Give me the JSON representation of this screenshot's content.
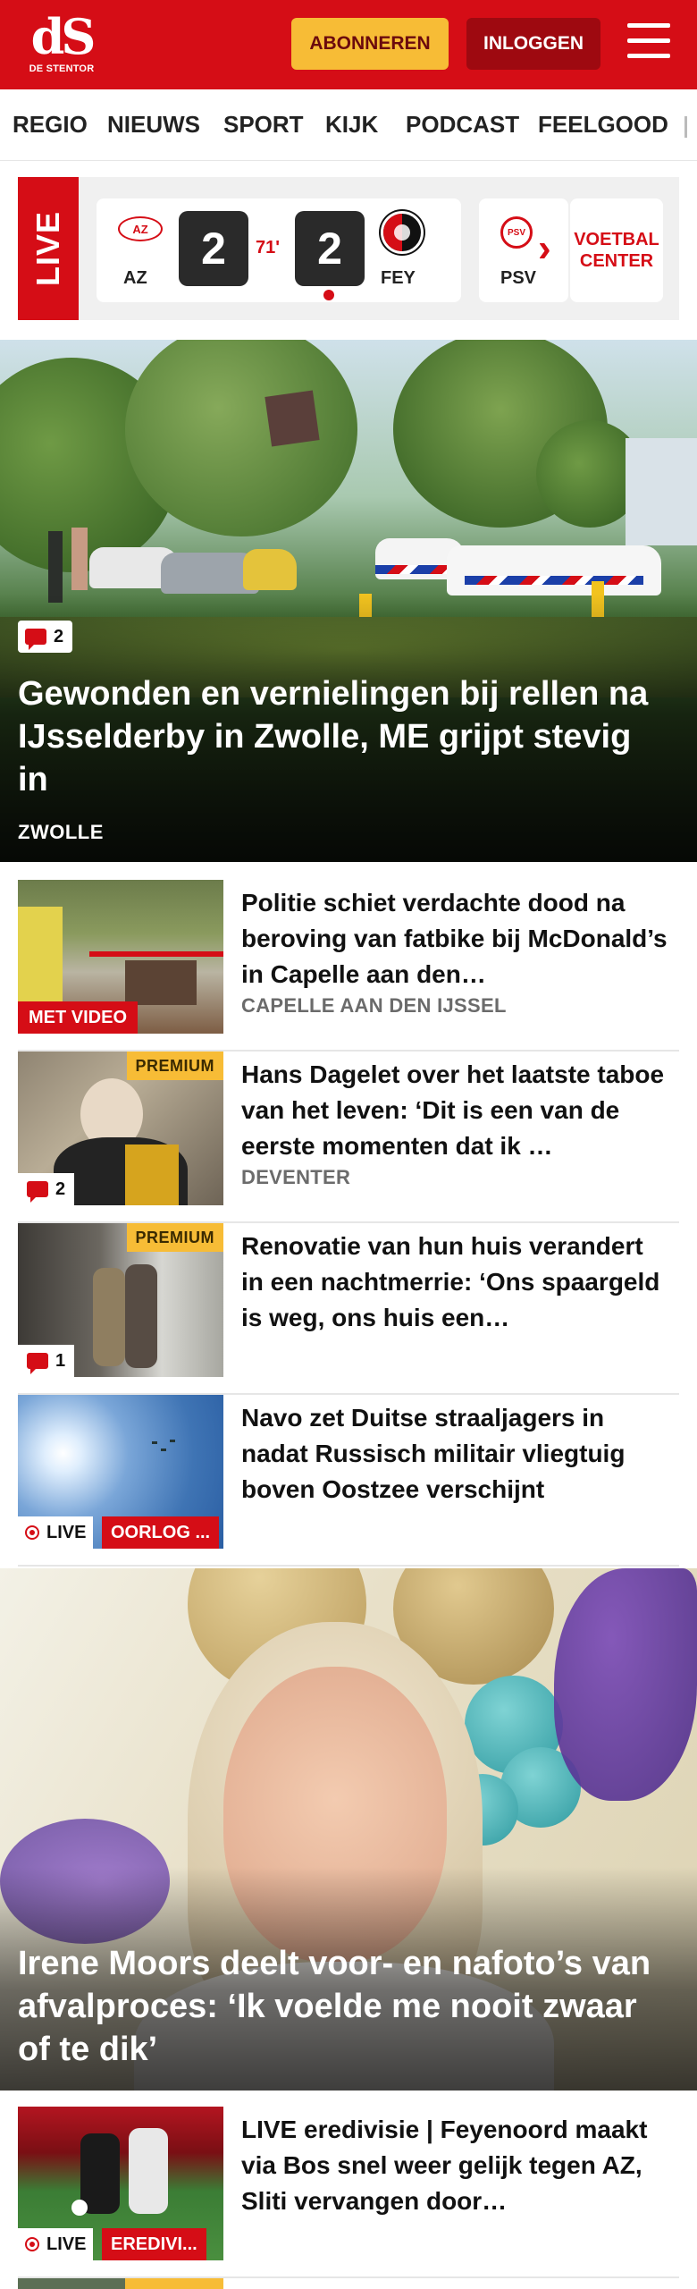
{
  "header": {
    "logo_mark": "dS",
    "logo_sub": "DE STENTOR",
    "subscribe_label": "ABONNEREN",
    "login_label": "INLOGGEN",
    "brand_color": "#d50d16"
  },
  "nav": {
    "items": [
      "REGIO",
      "NIEUWS",
      "SPORT",
      "KIJK",
      "PODCAST",
      "FEELGOOD"
    ]
  },
  "live_strip": {
    "live_label": "LIVE",
    "match": {
      "home_logo": "AZ",
      "home": "AZ",
      "home_score": "2",
      "minute": "71'",
      "away_score": "2",
      "away": "FEY"
    },
    "next_match": {
      "home_logo": "PSV",
      "home": "PSV"
    },
    "voetbal_line1": "VOETBAL",
    "voetbal_line2": "CENTER"
  },
  "hero1": {
    "comments": "2",
    "title": "Gewonden en vernielingen bij rellen na IJsselderby in Zwolle, ME grijpt stevig in",
    "location": "ZWOLLE"
  },
  "articles": [
    {
      "title": "Politie schiet verdachte dood na beroving van fatbike bij McDonald’s in Capelle aan den…",
      "location": "CAPELLE AAN DEN IJSSEL",
      "badge": "MET VIDEO"
    },
    {
      "title": "Hans Dagelet over het laatste taboe van het leven: ‘Dit is een van de eerste momenten dat ik …",
      "location": "DEVENTER",
      "premium": "PREMIUM",
      "comments": "2"
    },
    {
      "title": "Renovatie van hun huis verandert in een nachtmerrie: ‘Ons spaargeld is weg, ons huis een…",
      "premium": "PREMIUM",
      "comments": "1"
    },
    {
      "title": "Navo zet Duitse straaljagers in nadat Russisch militair vliegtuig boven Oostzee verschijnt",
      "live": "LIVE",
      "category": "OORLOG ..."
    }
  ],
  "hero2": {
    "title": "Irene Moors deelt voor- en nafoto’s van afvalproces: ‘Ik voelde me nooit zwaar of te dik’"
  },
  "article5": {
    "title": "LIVE eredivisie | Feyenoord maakt via Bos snel weer gelijk tegen AZ, Sliti vervangen door…",
    "live": "LIVE",
    "category": "EREDIVI..."
  }
}
